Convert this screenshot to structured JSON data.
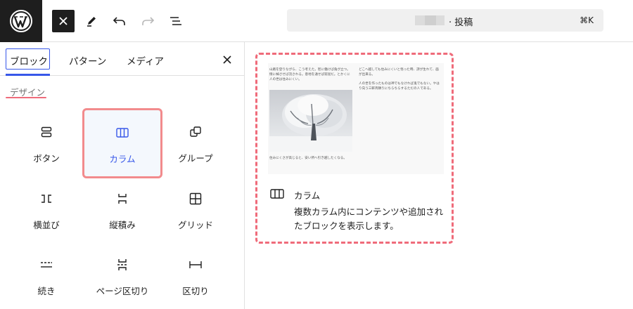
{
  "toolbar": {
    "command_bar": {
      "title": "· 投稿",
      "shortcut": "⌘K"
    }
  },
  "inserter": {
    "tabs": [
      {
        "label": "ブロック",
        "active": true
      },
      {
        "label": "パターン",
        "active": false
      },
      {
        "label": "メディア",
        "active": false
      }
    ],
    "category": "デザイン",
    "blocks": [
      {
        "label": "ボタン",
        "icon": "buttons-icon"
      },
      {
        "label": "カラム",
        "icon": "columns-icon",
        "highlighted": true
      },
      {
        "label": "グループ",
        "icon": "group-icon"
      },
      {
        "label": "横並び",
        "icon": "row-icon"
      },
      {
        "label": "縦積み",
        "icon": "stack-icon"
      },
      {
        "label": "グリッド",
        "icon": "grid-icon"
      },
      {
        "label": "続き",
        "icon": "more-icon"
      },
      {
        "label": "ページ区切り",
        "icon": "page-break-icon"
      },
      {
        "label": "区切り",
        "icon": "spacer-icon"
      }
    ]
  },
  "preview": {
    "col1_text": "山路を登りながら、こう考えた。智に働けば角が立つ。情に棹させば流される。意地を通せば窮屈だ。とかくに人の世は住みにくい。",
    "col1_caption": "住みにくさが高じると、安い所へ引き越したくなる。",
    "col2_text_1": "どこへ越しても住みにくいと悟った時、詩が生れて、画が出来る。",
    "col2_text_2": "人の世を作ったものは神でもなければ鬼でもない。やはり向う三軒両隣りにちらちらするただの人である。",
    "block_title": "カラム",
    "block_description": "複数カラム内にコンテンツや追加されたブロックを表示します。"
  },
  "colors": {
    "accent": "#3858e9",
    "highlight_border": "#f28b8d",
    "dark": "#1e1e1e"
  }
}
